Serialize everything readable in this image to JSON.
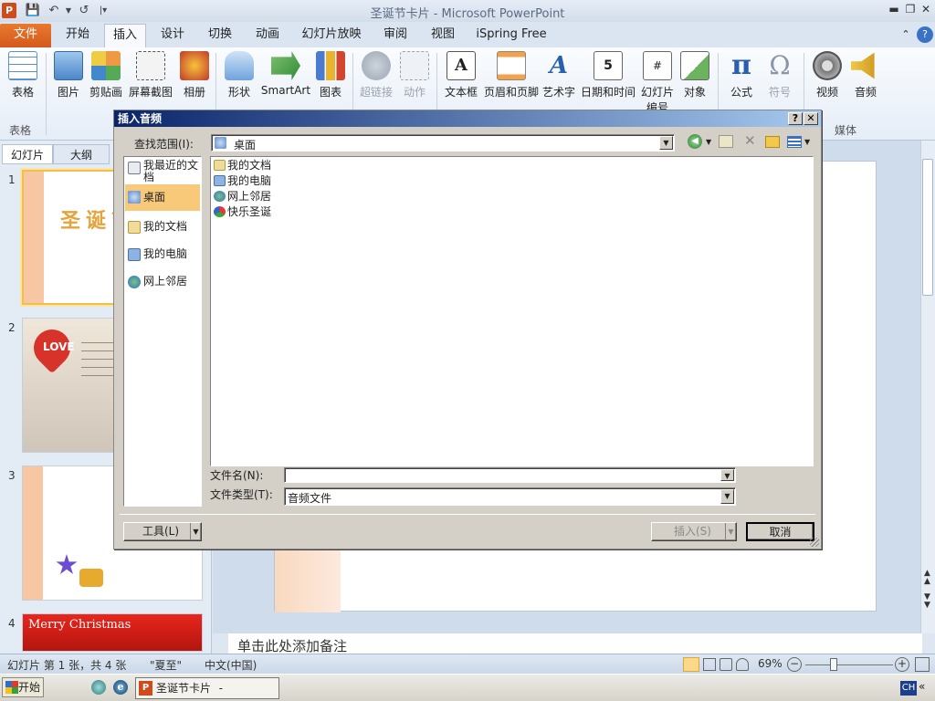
{
  "window": {
    "app_icon": "P",
    "title": "圣诞节卡片 - Microsoft PowerPoint"
  },
  "tabs": [
    "文件",
    "开始",
    "插入",
    "设计",
    "切换",
    "动画",
    "幻灯片放映",
    "审阅",
    "视图",
    "iSpring Free"
  ],
  "ribbon": {
    "buttons": [
      "表格",
      "图片",
      "剪贴画",
      "屏幕截图",
      "相册",
      "形状",
      "SmartArt",
      "图表",
      "超链接",
      "动作",
      "文本框",
      "页眉和页脚",
      "艺术字",
      "日期和时间",
      "幻灯片编号",
      "对象",
      "公式",
      "符号",
      "视频",
      "音频"
    ],
    "group_labels": [
      "表格",
      "媒体"
    ]
  },
  "left_pane": {
    "tabs": [
      "幻灯片",
      "大纲"
    ],
    "slide_numbers": [
      "1",
      "2",
      "3",
      "4"
    ],
    "slide1_title": "圣诞节",
    "slide2_heart": "LOVE",
    "slide4_title": "Merry Christmas"
  },
  "notes_placeholder": "单击此处添加备注",
  "status": {
    "slide_info": "幻灯片 第 1 张，共 4 张",
    "theme": "\"夏至\"",
    "language": "中文(中国)",
    "zoom": "69%",
    "zoom_level_percent": 69
  },
  "taskbar": {
    "start": "开始",
    "window_item": "圣诞节卡片 - Micros...",
    "ime": "CH"
  },
  "dialog": {
    "title": "插入音频",
    "lookin_label": "查找范围(I):",
    "lookin_value": "桌面",
    "places": [
      "我最近的文档",
      "桌面",
      "我的文档",
      "我的电脑",
      "网上邻居"
    ],
    "selected_place": "桌面",
    "files": [
      "我的文档",
      "我的电脑",
      "网上邻居",
      "快乐圣诞"
    ],
    "filename_label": "文件名(N):",
    "filename_value": "",
    "filetype_label": "文件类型(T):",
    "filetype_value": "音频文件",
    "tools_button": "工具(L)",
    "insert_button": "插入(S)",
    "cancel_button": "取消"
  },
  "colors": {
    "file_tab": "#e06a25",
    "dialog_title": "#0a246a",
    "selection": "#f9c97a"
  }
}
